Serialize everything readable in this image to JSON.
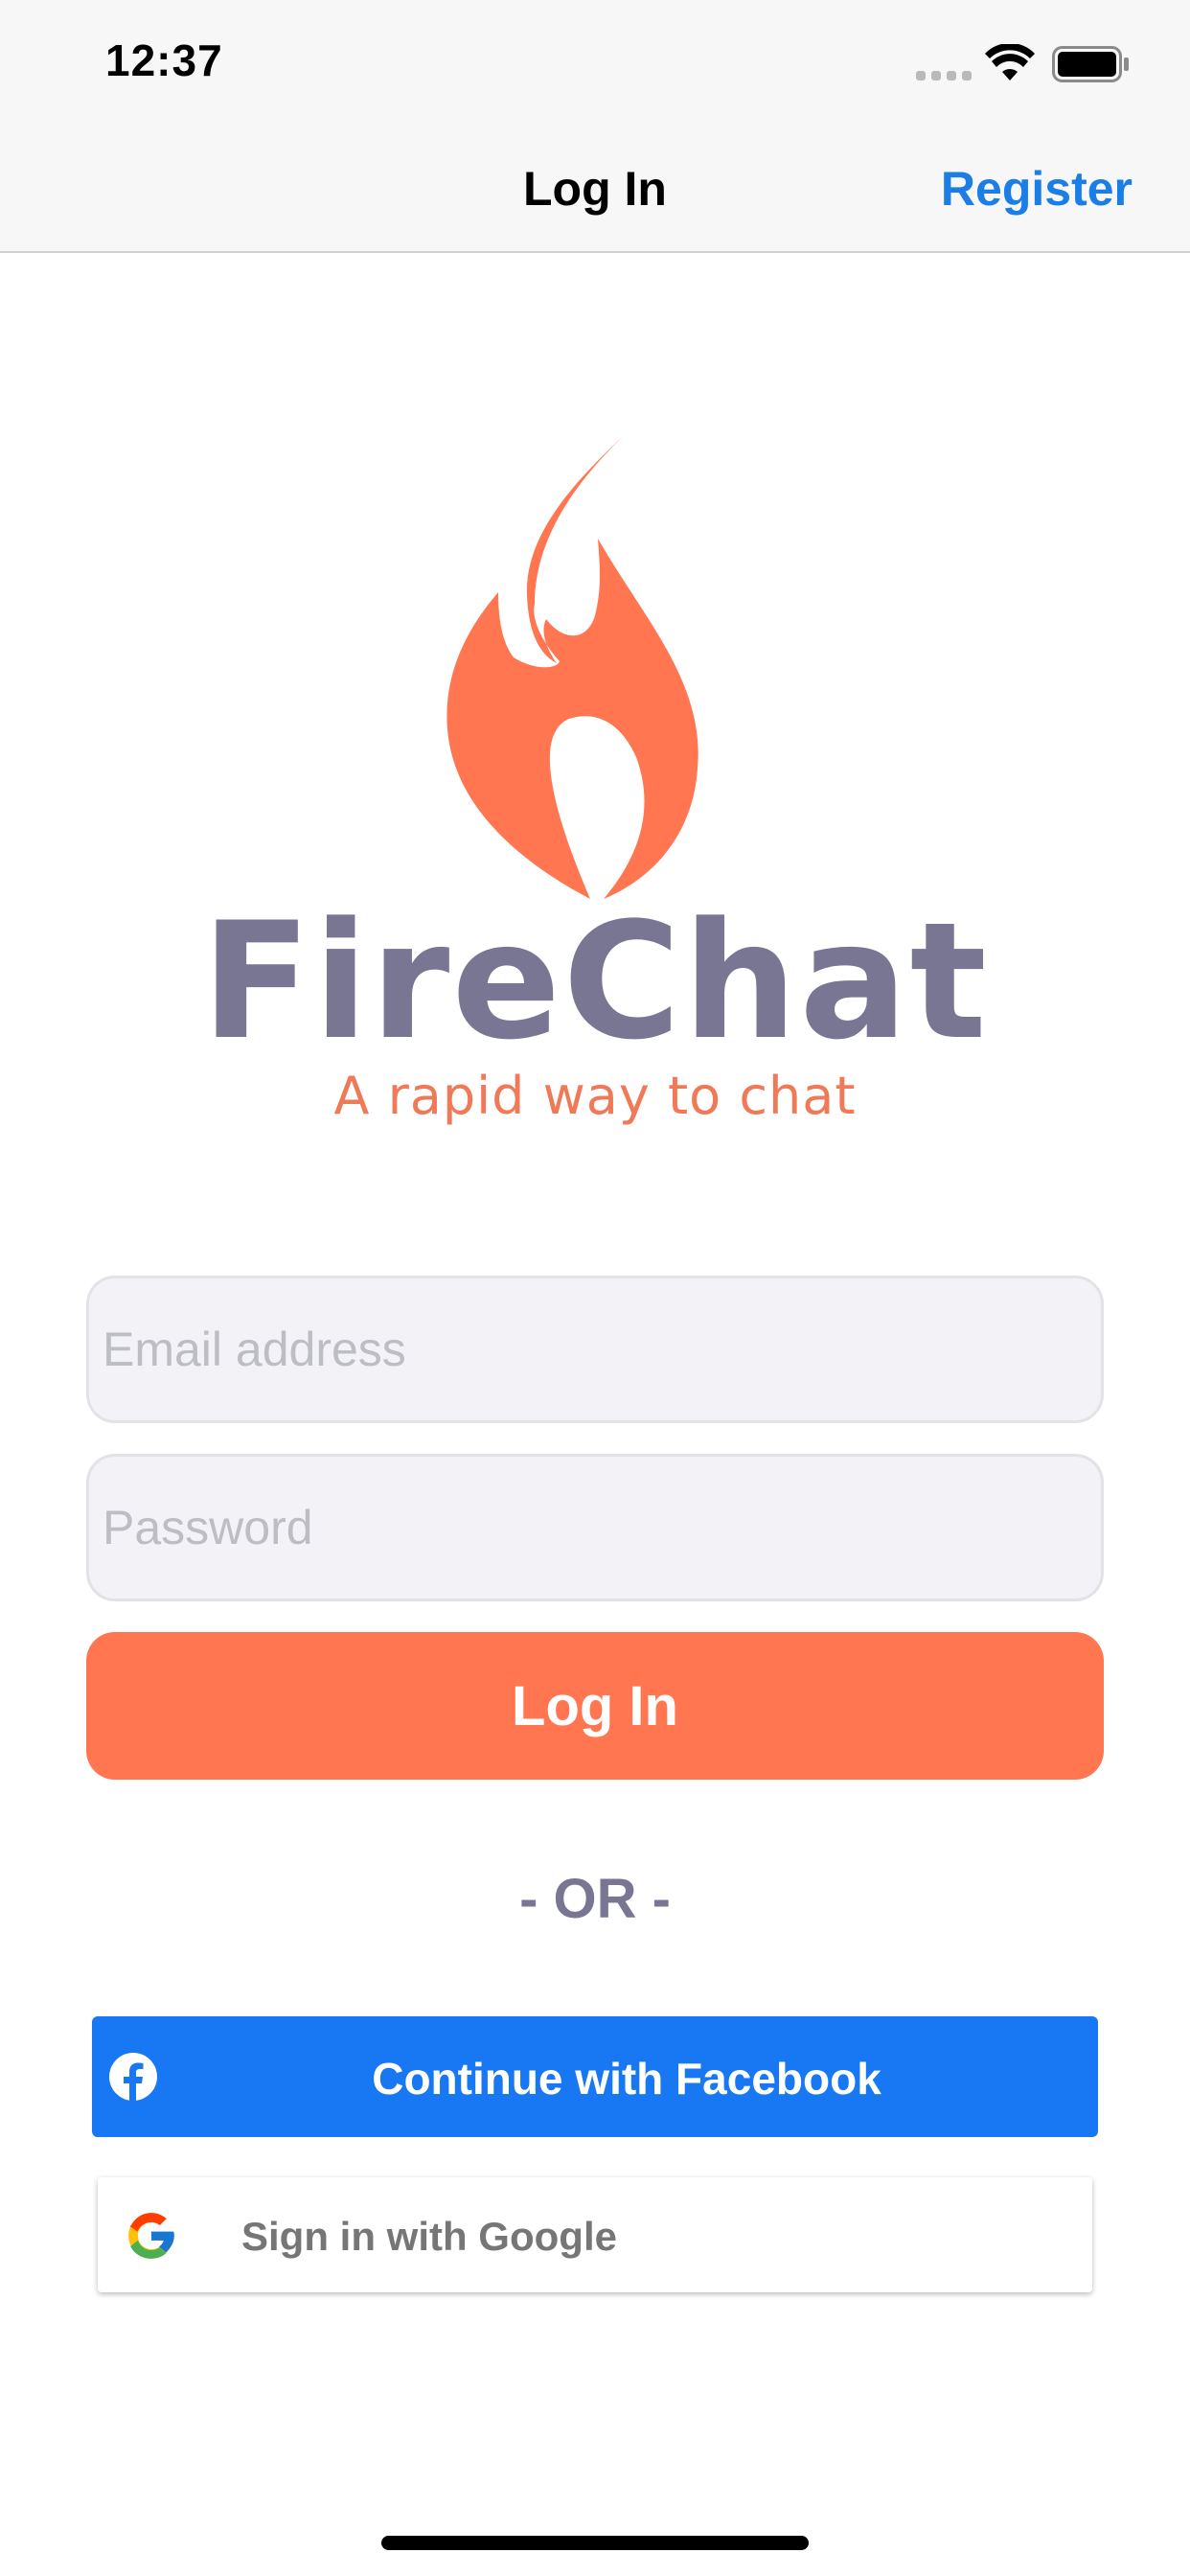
{
  "status_bar": {
    "time": "12:37"
  },
  "nav": {
    "title": "Log In",
    "register_label": "Register"
  },
  "logo": {
    "wordmark": "FireChat",
    "tagline": "A rapid way to chat"
  },
  "form": {
    "email_placeholder": "Email address",
    "password_placeholder": "Password",
    "login_label": "Log In"
  },
  "divider_text": "- OR -",
  "social": {
    "facebook_label": "Continue with Facebook",
    "google_label": "Sign in with Google"
  },
  "colors": {
    "accent": "#ff7651",
    "link_blue": "#1a7ee6",
    "wordmark_gray": "#787693",
    "facebook_blue": "#1877f2"
  }
}
